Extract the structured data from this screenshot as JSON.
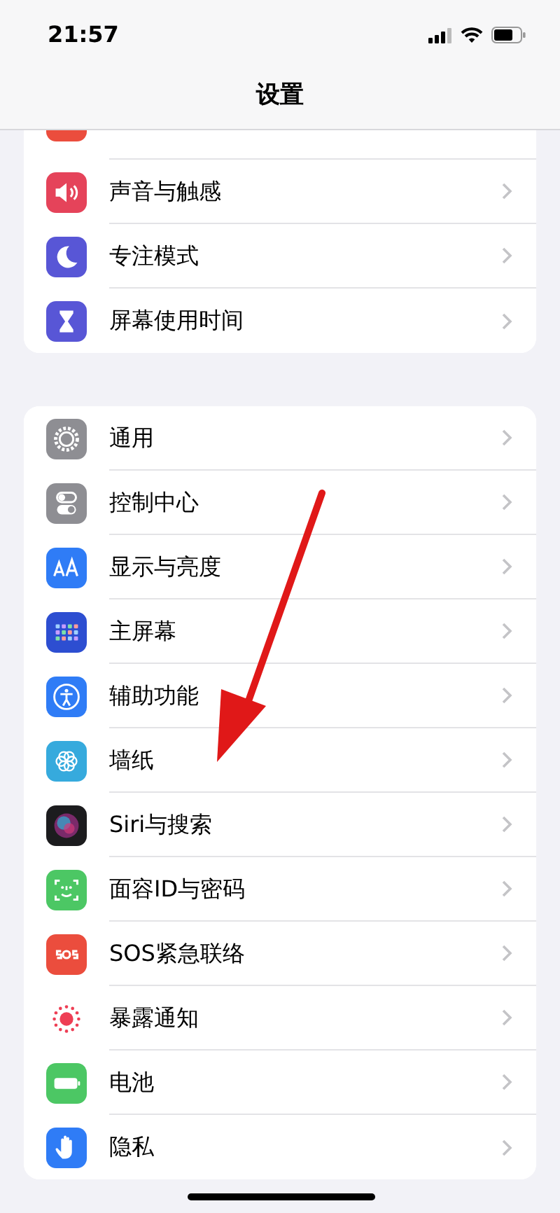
{
  "status_bar": {
    "time": "21:57"
  },
  "nav": {
    "title": "设置"
  },
  "sections": [
    {
      "items": [
        {
          "label": "声音与触感"
        },
        {
          "label": "专注模式"
        },
        {
          "label": "屏幕使用时间"
        }
      ]
    },
    {
      "items": [
        {
          "label": "通用"
        },
        {
          "label": "控制中心"
        },
        {
          "label": "显示与亮度"
        },
        {
          "label": "主屏幕"
        },
        {
          "label": "辅助功能"
        },
        {
          "label": "墙纸"
        },
        {
          "label": "Siri与搜索"
        },
        {
          "label": "面容ID与密码"
        },
        {
          "label": "SOS紧急联络"
        },
        {
          "label": "暴露通知"
        },
        {
          "label": "电池"
        },
        {
          "label": "隐私"
        }
      ]
    }
  ]
}
